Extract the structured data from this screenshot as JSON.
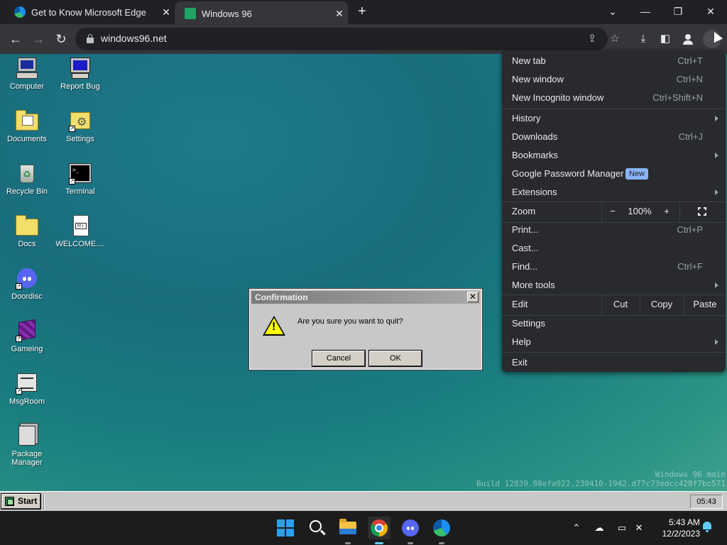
{
  "browser": {
    "tabs": [
      {
        "title": "Get to Know Microsoft Edge",
        "favicon": "edge-icon"
      },
      {
        "title": "Windows 96",
        "favicon": "windows96-icon",
        "active": true
      }
    ],
    "new_tab_label": "+",
    "window_controls": {
      "tab_search": "⌄",
      "minimize": "—",
      "restore": "❐",
      "close": "✕"
    },
    "url": "windows96.net",
    "nav": {
      "back": "←",
      "forward": "→",
      "reload": "↻"
    },
    "toolbar_icons": {
      "share": "⇪",
      "bookmark": "☆",
      "download": "⤓",
      "sidepanel": "◧"
    }
  },
  "chrome_menu": {
    "items": [
      {
        "label": "New tab",
        "shortcut": "Ctrl+T"
      },
      {
        "label": "New window",
        "shortcut": "Ctrl+N"
      },
      {
        "label": "New Incognito window",
        "shortcut": "Ctrl+Shift+N"
      },
      {
        "label": "History",
        "submenu": true
      },
      {
        "label": "Downloads",
        "shortcut": "Ctrl+J"
      },
      {
        "label": "Bookmarks",
        "submenu": true
      },
      {
        "label": "Google Password Manager",
        "badge": "New"
      },
      {
        "label": "Extensions",
        "submenu": true
      },
      {
        "label": "Zoom"
      },
      {
        "label": "Print...",
        "shortcut": "Ctrl+P"
      },
      {
        "label": "Cast..."
      },
      {
        "label": "Find...",
        "shortcut": "Ctrl+F"
      },
      {
        "label": "More tools",
        "submenu": true
      },
      {
        "label": "Edit"
      },
      {
        "label": "Settings"
      },
      {
        "label": "Help",
        "submenu": true
      },
      {
        "label": "Exit"
      }
    ],
    "zoom": {
      "minus": "−",
      "value": "100%",
      "plus": "+"
    },
    "edit": {
      "cut": "Cut",
      "copy": "Copy",
      "paste": "Paste"
    }
  },
  "desktop": {
    "icons": [
      {
        "label": "Computer",
        "icon": "computer-icon"
      },
      {
        "label": "Report Bug",
        "icon": "report-bug-icon"
      },
      {
        "label": "Documents",
        "icon": "documents-icon"
      },
      {
        "label": "Settings",
        "icon": "settings-icon"
      },
      {
        "label": "Recycle Bin",
        "icon": "recycle-bin-icon"
      },
      {
        "label": "Terminal",
        "icon": "terminal-icon"
      },
      {
        "label": "Docs",
        "icon": "folder-icon"
      },
      {
        "label": "WELCOME....",
        "icon": "markdown-file-icon"
      },
      {
        "label": "Doordisc",
        "icon": "discord-icon"
      },
      {
        "label": "Gameing",
        "icon": "cube-icon"
      },
      {
        "label": "MsgRoom",
        "icon": "msgroom-icon"
      },
      {
        "label": "Package Manager",
        "icon": "package-icon"
      }
    ],
    "build_line1": "Windows 96 main",
    "build_line2": "Build 12839.88efa922.230410-1942.d77c73edcc428f7bc571"
  },
  "dialog": {
    "title": "Confirmation",
    "close": "✕",
    "message": "Are you sure you want to quit?",
    "icon": "warning-icon",
    "cancel": "Cancel",
    "ok": "OK"
  },
  "w96_taskbar": {
    "start_label": "Start",
    "clock": "05:43"
  },
  "win_taskbar": {
    "apps": [
      "start-icon",
      "search-icon",
      "file-explorer-icon",
      "chrome-icon",
      "discord-icon",
      "edge-icon"
    ],
    "tray": {
      "chevron": "⌃",
      "time": "5:43 AM",
      "date": "12/2/2023"
    }
  },
  "colors": {
    "chrome_dark": "#202124",
    "chrome_toolbar": "#35363a",
    "menu_bg": "#292a2d",
    "badge_new": "#8ab4f8",
    "desktop_teal": "#1e7a8a",
    "w96_gray": "#c8c8c8"
  }
}
